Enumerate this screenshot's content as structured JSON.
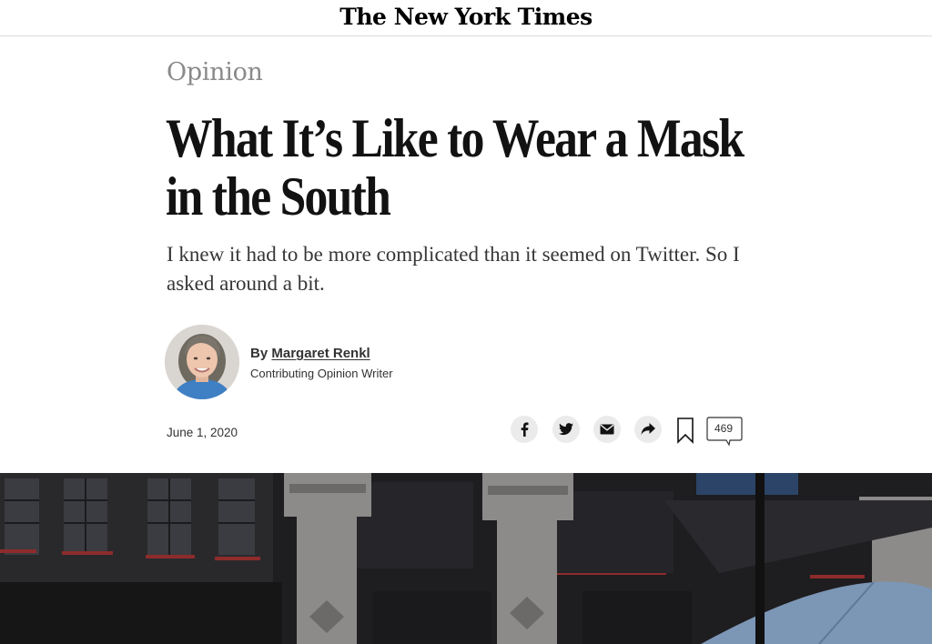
{
  "masthead": {
    "logo": "The New York Times"
  },
  "article": {
    "section": "Opinion",
    "headline": "What It’s Like to Wear a Mask in the South",
    "summary": "I knew it had to be more complicated than it seemed on Twitter. So I asked around a bit.",
    "byline": {
      "prefix": "By",
      "author": "Margaret Renkl",
      "role": "Contributing Opinion Writer"
    },
    "date": "June 1, 2020"
  },
  "share": {
    "icons": [
      "facebook-icon",
      "twitter-icon",
      "email-icon",
      "share-icon",
      "bookmark-icon",
      "comment-icon"
    ],
    "comment_count": "469"
  }
}
